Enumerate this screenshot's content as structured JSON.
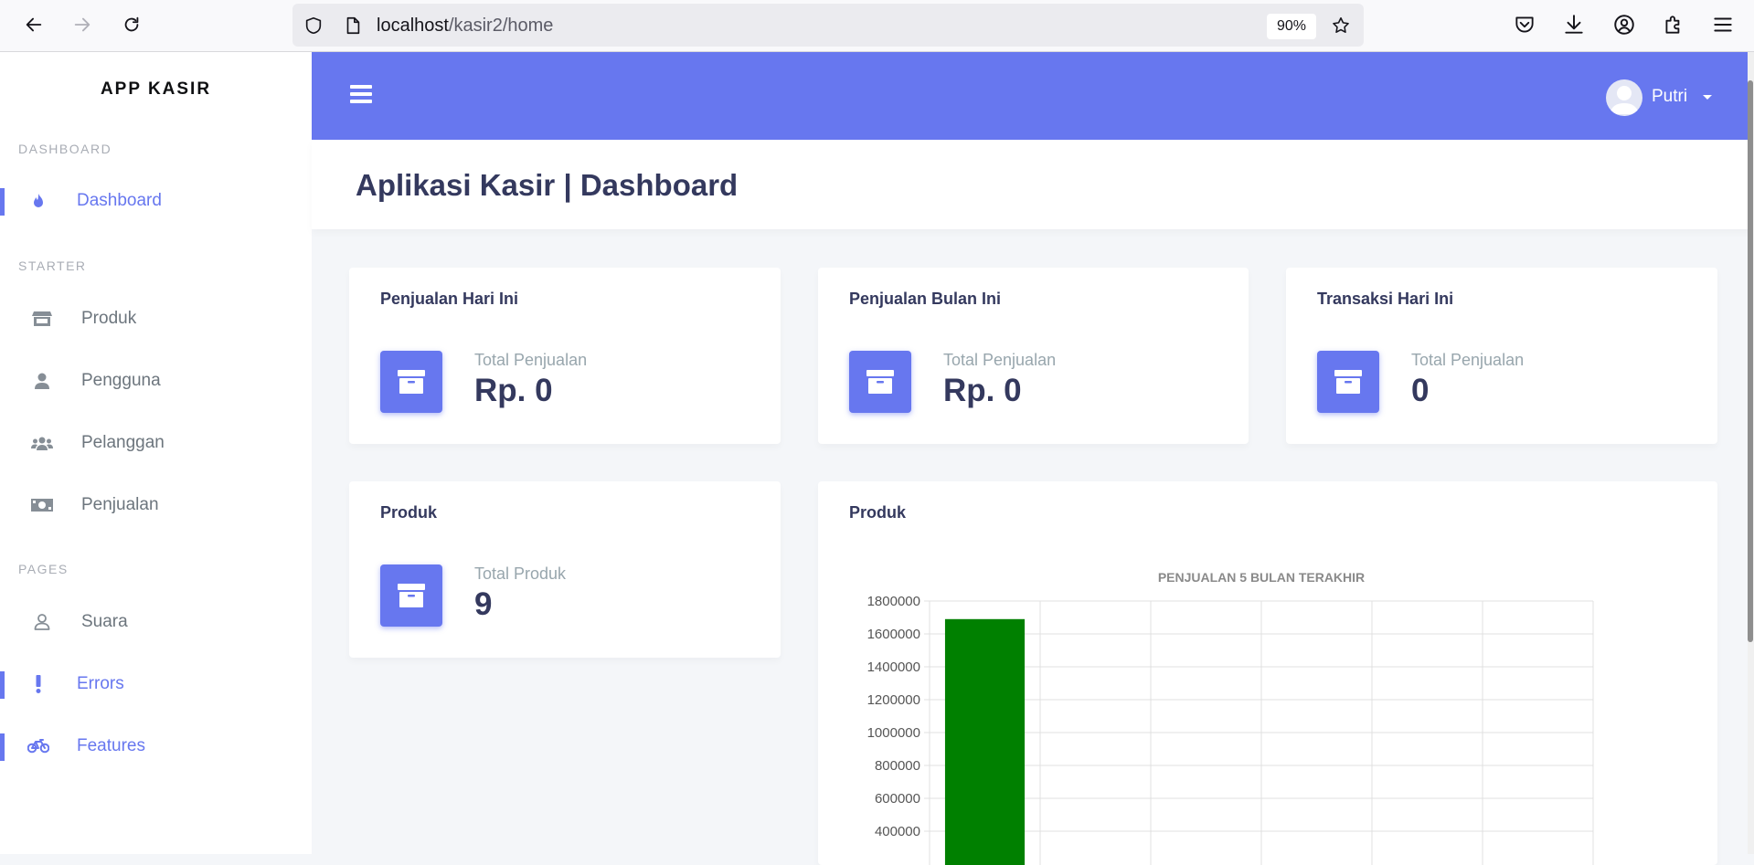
{
  "browser": {
    "url_host": "localhost",
    "url_path": "/kasir2/home",
    "zoom": "90%"
  },
  "sidebar": {
    "brand": "APP KASIR",
    "headers": [
      "DASHBOARD",
      "STARTER",
      "PAGES"
    ],
    "items": [
      {
        "label": "Dashboard",
        "icon": "fire-icon",
        "active": true
      },
      {
        "label": "Produk",
        "icon": "store-icon",
        "active": false
      },
      {
        "label": "Pengguna",
        "icon": "user-icon",
        "active": false
      },
      {
        "label": "Pelanggan",
        "icon": "users-icon",
        "active": false
      },
      {
        "label": "Penjualan",
        "icon": "money-icon",
        "active": false
      },
      {
        "label": "Suara",
        "icon": "user-outline-icon",
        "active": false
      },
      {
        "label": "Errors",
        "icon": "exclamation-icon",
        "active": true
      },
      {
        "label": "Features",
        "icon": "bicycle-icon",
        "active": true
      }
    ]
  },
  "navbar": {
    "user_name": "Putri"
  },
  "page": {
    "title": "Aplikasi Kasir | Dashboard"
  },
  "cards": [
    {
      "title": "Penjualan Hari Ini",
      "label": "Total Penjualan",
      "value": "Rp. 0"
    },
    {
      "title": "Penjualan Bulan Ini",
      "label": "Total Penjualan",
      "value": "Rp. 0"
    },
    {
      "title": "Transaksi Hari Ini",
      "label": "Total Penjualan",
      "value": "0"
    },
    {
      "title": "Produk",
      "label": "Total Produk",
      "value": "9"
    }
  ],
  "chart_card": {
    "title": "Produk"
  },
  "chart_data": {
    "type": "bar",
    "title": "PENJUALAN 5 BULAN TERAKHIR",
    "categories": [
      "",
      "",
      "",
      "",
      "",
      ""
    ],
    "values": [
      1690000,
      null,
      null,
      null,
      null,
      null
    ],
    "bar_color": "#008000",
    "yticks": [
      "1800000",
      "1600000",
      "1400000",
      "1200000",
      "1000000",
      "800000",
      "600000",
      "400000"
    ],
    "ylim": [
      0,
      1800000
    ],
    "grid": true
  },
  "colors": {
    "primary": "#6777ef",
    "heading": "#34395e",
    "muted": "#98a6ad"
  }
}
